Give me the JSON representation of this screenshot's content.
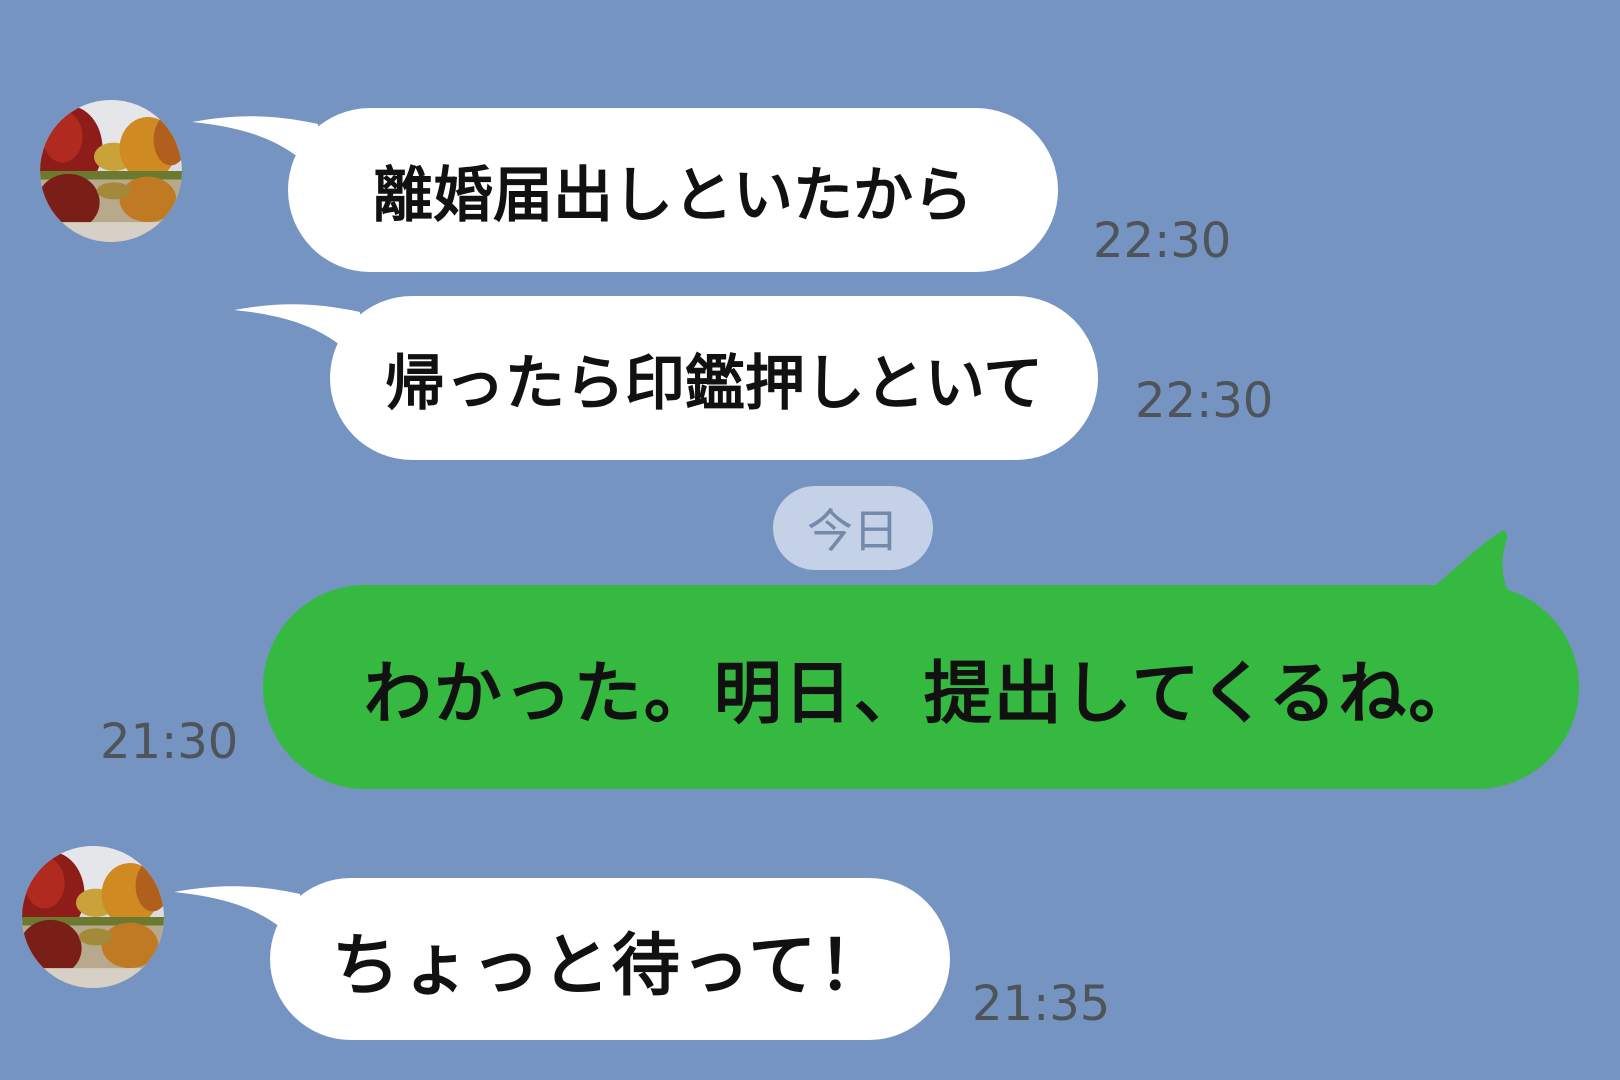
{
  "background_color": "#7594c2",
  "incoming_bubble_color": "#ffffff",
  "outgoing_bubble_color": "#36b940",
  "avatar_icon": "autumn-lake-photo",
  "messages": [
    {
      "direction": "incoming",
      "text": "離婚届出しといたから",
      "time": "22:30"
    },
    {
      "direction": "incoming",
      "text": "帰ったら印鑑押しといて",
      "time": "22:30"
    },
    {
      "direction": "outgoing",
      "text": "わかった。明日、提出してくるね。",
      "time": "21:30"
    },
    {
      "direction": "incoming",
      "text": "ちょっと待って！",
      "time": "21:35"
    }
  ],
  "date_separator": "今日"
}
